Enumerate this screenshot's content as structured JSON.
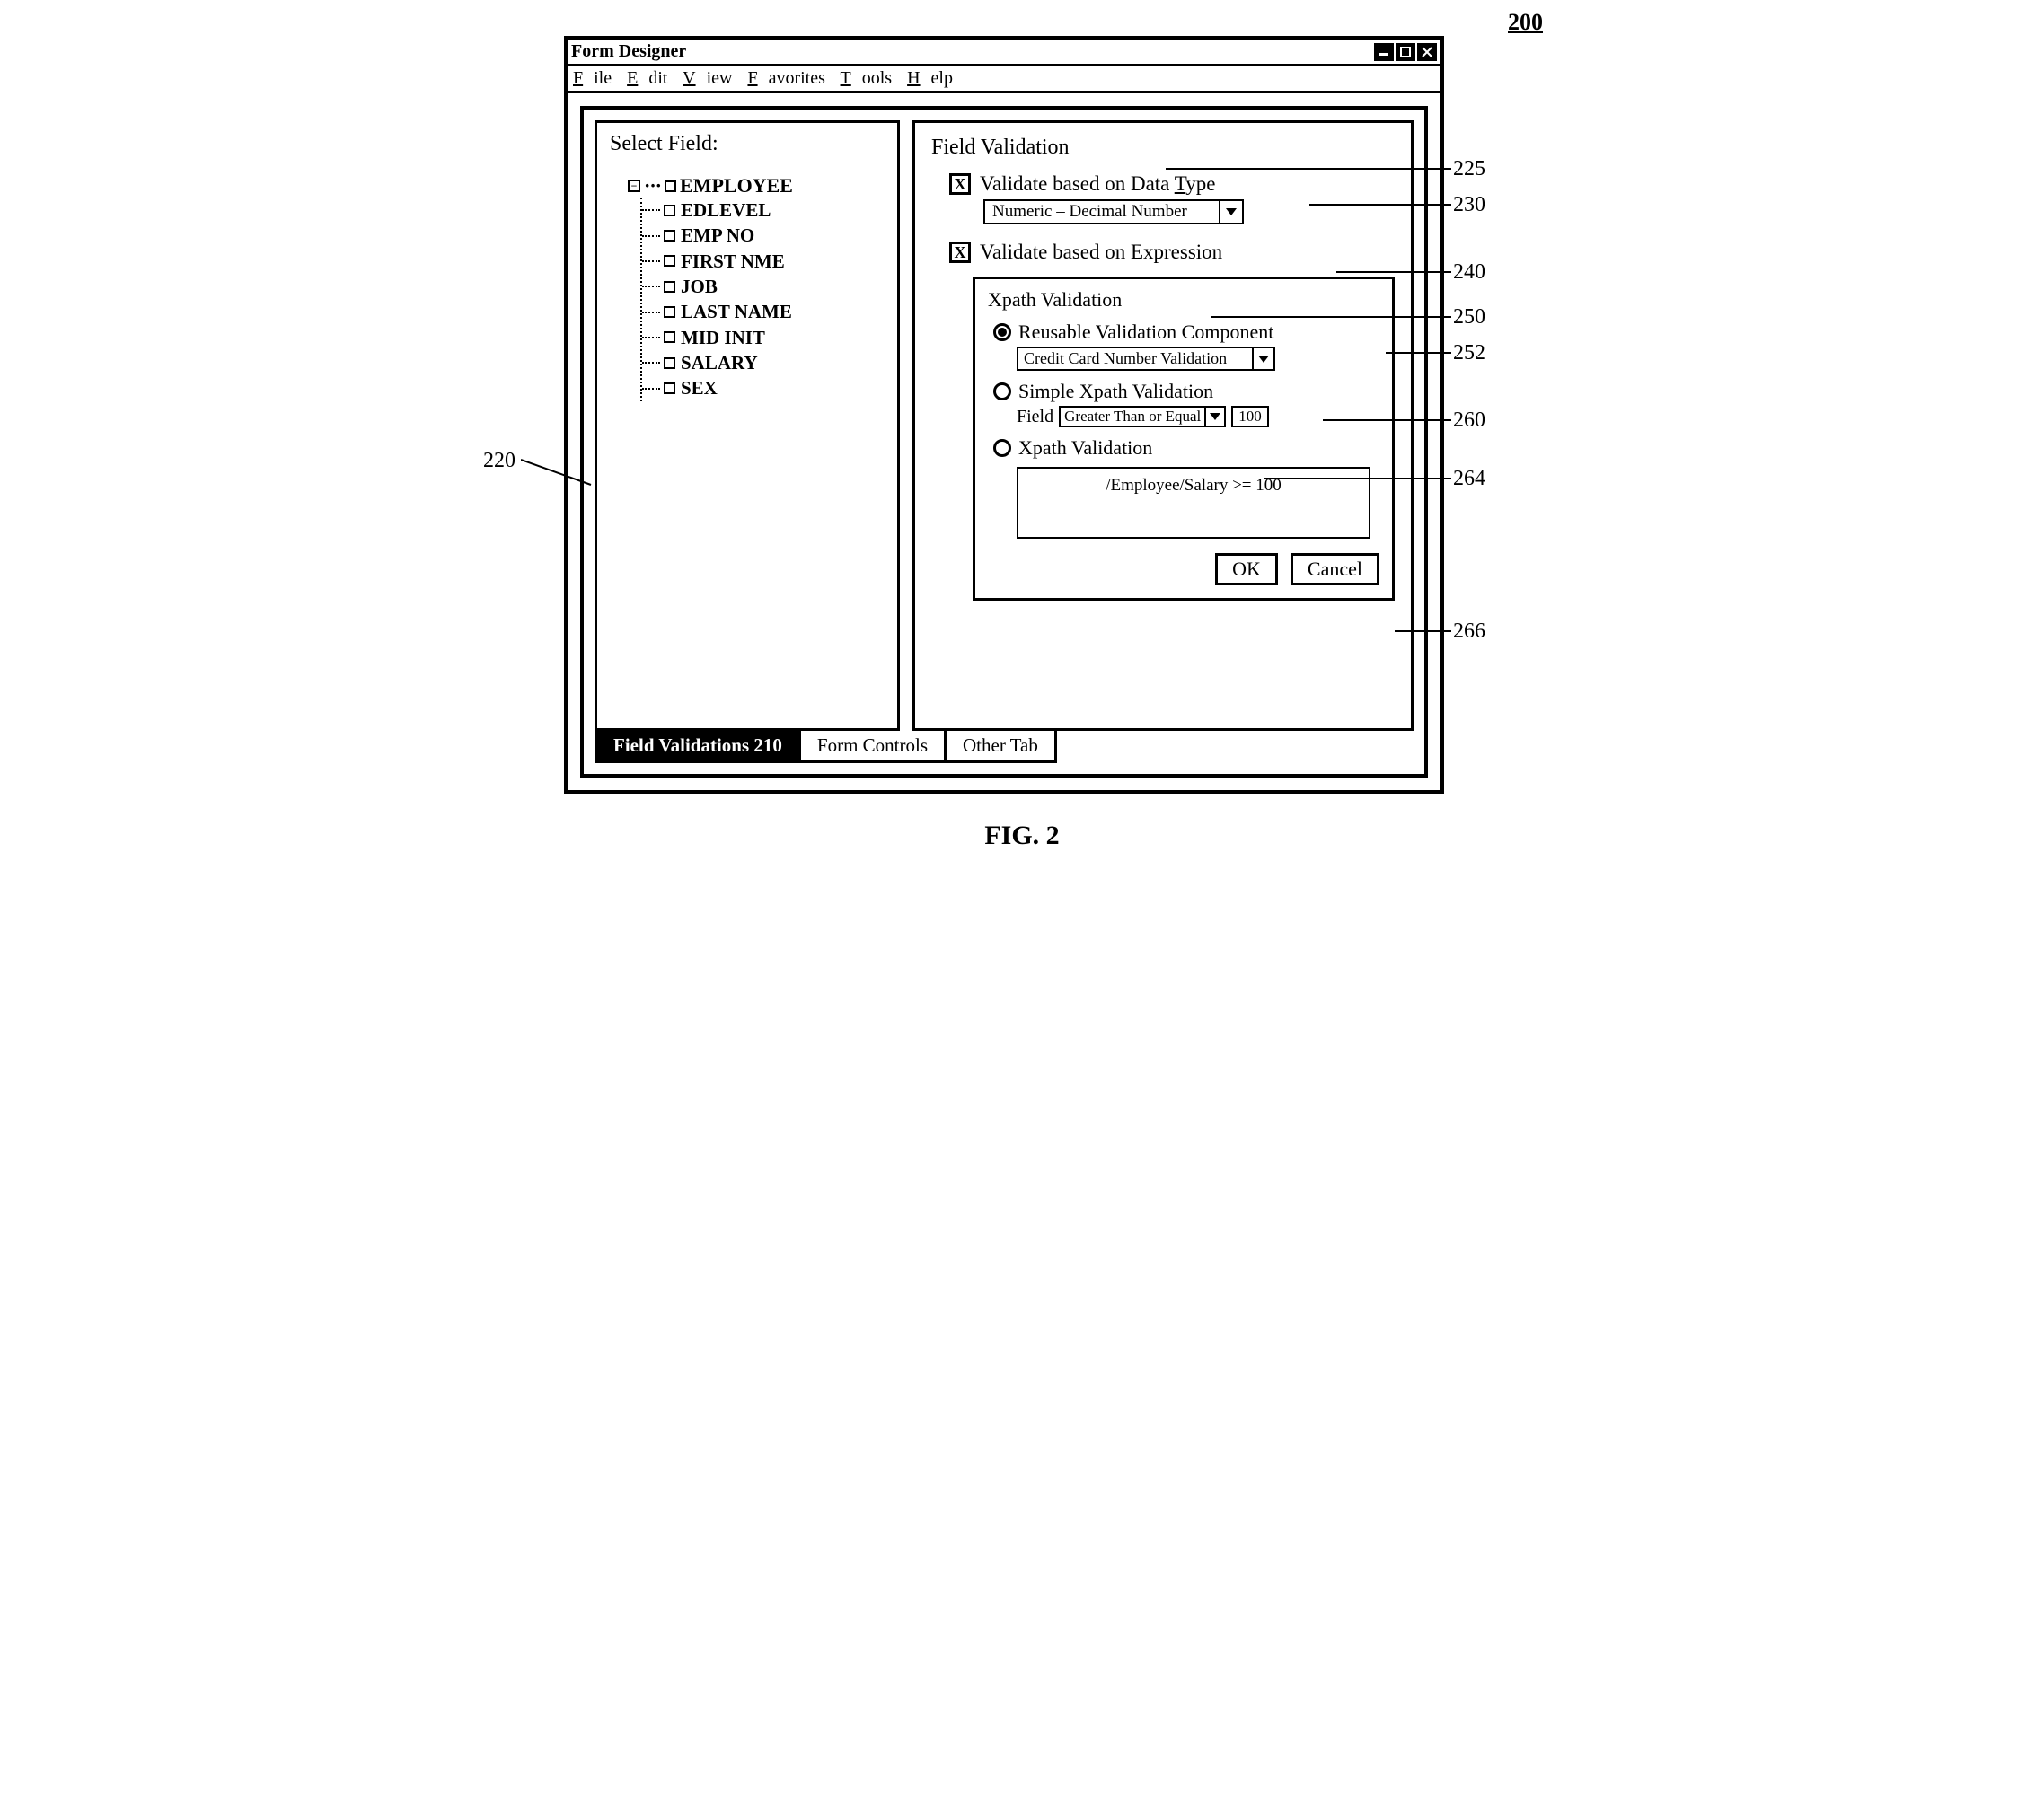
{
  "figure_number_top": "200",
  "figure_caption": "FIG. 2",
  "window": {
    "title": "Form Designer",
    "menu": [
      "File",
      "Edit",
      "View",
      "Favorites",
      "Tools",
      "Help"
    ]
  },
  "left_panel": {
    "title": "Select Field:",
    "root": "EMPLOYEE",
    "children": [
      "EDLEVEL",
      "EMP NO",
      "FIRST NME",
      "JOB",
      "LAST NAME",
      "MID INIT",
      "SALARY",
      "SEX"
    ]
  },
  "right_panel": {
    "title": "Field Validation",
    "datatype_label_pre": "Validate based on Data ",
    "datatype_label_u": "T",
    "datatype_label_post": "ype",
    "datatype_value": "Numeric – Decimal Number",
    "expression_label": "Validate based on Expression",
    "xpath_group": "Xpath Validation",
    "reusable_label": "Reusable Validation Component",
    "reusable_value": "Credit Card Number Validation",
    "simple_label": "Simple Xpath Validation",
    "simple_field_label": "Field",
    "simple_op": "Greater Than or Equal",
    "simple_val": "100",
    "xpath_label": "Xpath Validation",
    "xpath_expr": "/Employee/Salary >= 100",
    "ok": "OK",
    "cancel": "Cancel"
  },
  "tabs": [
    "Field Validations 210",
    "Form Controls",
    "Other Tab"
  ],
  "callouts": {
    "c220": "220",
    "c225": "225",
    "c230": "230",
    "c240": "240",
    "c250": "250",
    "c252": "252",
    "c260": "260",
    "c264": "264",
    "c266": "266"
  }
}
